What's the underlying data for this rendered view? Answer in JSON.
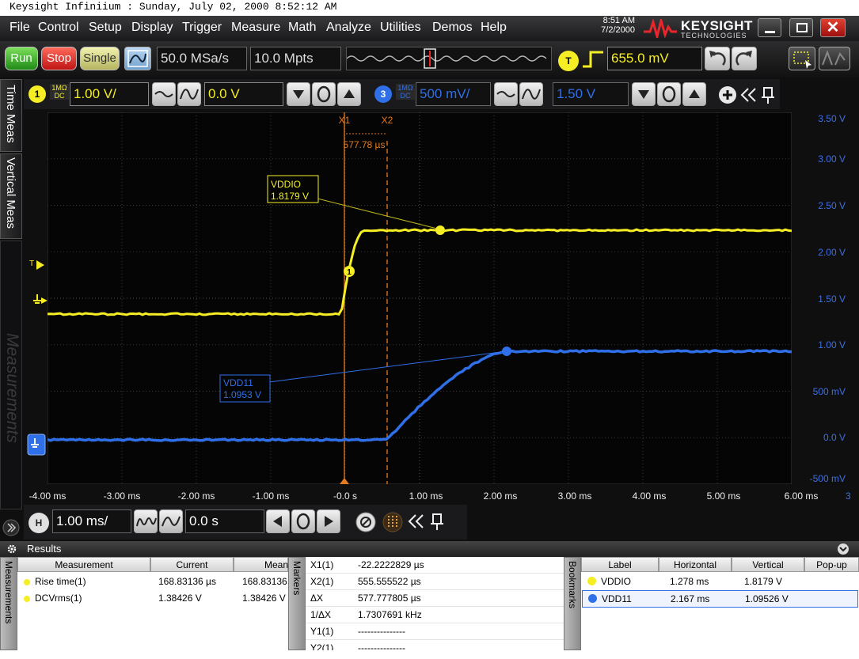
{
  "window_title": "Keysight Infiniium : Sunday, July 02, 2000 8:52:12 AM",
  "menu": [
    "File",
    "Control",
    "Setup",
    "Display",
    "Trigger",
    "Measure",
    "Math",
    "Analyze",
    "Utilities",
    "Demos",
    "Help"
  ],
  "clock": {
    "time": "8:51 AM",
    "date": "7/2/2000"
  },
  "brand": {
    "name": "KEYSIGHT",
    "sub": "TECHNOLOGIES"
  },
  "toolbar": {
    "run": "Run",
    "stop": "Stop",
    "single": "Single",
    "sample_rate": "50.0 MSa/s",
    "memory_depth": "10.0 Mpts",
    "trigger_badge": "T",
    "trigger_level": "655.0 mV"
  },
  "channel1": {
    "number": "1",
    "coupling_top": "1MΩ",
    "coupling_bot": "DC",
    "scale": "1.00 V/",
    "offset": "0.0 V",
    "color": "#f6ee25"
  },
  "channel3": {
    "number": "3",
    "coupling_top": "1MΩ",
    "coupling_bot": "DC",
    "scale": "500 mV/",
    "offset": "1.50 V",
    "color": "#2f6fe8"
  },
  "sidetabs": {
    "time_meas": "Time Meas",
    "vertical_meas": "Vertical Meas",
    "measurements": "Measurements"
  },
  "scope": {
    "y_labels": [
      "3.50 V",
      "3.00 V",
      "2.50 V",
      "2.00 V",
      "1.50 V",
      "1.00 V",
      "500 mV",
      "0.0 V",
      "-500 mV"
    ],
    "x_labels": [
      "-4.00 ms",
      "-3.00 ms",
      "-2.00 ms",
      "-1.00 ms",
      "-0.0 s",
      "1.00 ms",
      "2.00 ms",
      "3.00 ms",
      "4.00 ms",
      "5.00 ms",
      "6.00 ms"
    ],
    "x_extra": "3",
    "marker_x1": "X1",
    "marker_x2": "X2",
    "delta": "577.78 µs",
    "trig_marker": "T",
    "vddio_label": "VDDIO",
    "vddio_value": "1.8179 V",
    "vdd11_label": "VDD11",
    "vdd11_value": "1.0953 V",
    "meas_badge": "1"
  },
  "horizontal": {
    "badge": "H",
    "scale": "1.00 ms/",
    "position": "0.0 s"
  },
  "results": {
    "title": "Results",
    "measurements_tab": "Measurements",
    "markers_tab": "Markers",
    "bookmarks_tab": "Bookmarks",
    "meas_headers": [
      "Measurement",
      "Current",
      "Mean"
    ],
    "meas_rows": [
      {
        "name": "Rise time(1)",
        "current": "168.83136 µs",
        "mean": "168.83136"
      },
      {
        "name": "DCVrms(1)",
        "current": "1.38426 V",
        "mean": "1.38426 V"
      }
    ],
    "markers": [
      {
        "name": "X1(1)",
        "value": "-22.2222829 µs"
      },
      {
        "name": "X2(1)",
        "value": "555.555522 µs"
      },
      {
        "name": "ΔX",
        "value": "577.777805 µs"
      },
      {
        "name": "1/ΔX",
        "value": "1.7307691 kHz"
      },
      {
        "name": "Y1(1)",
        "value": "---------------"
      },
      {
        "name": "Y2(1)",
        "value": "---------------"
      }
    ],
    "bm_headers": [
      "Label",
      "Horizontal",
      "Vertical",
      "Pop-up"
    ],
    "bm_rows": [
      {
        "label": "VDDIO",
        "horizontal": "1.278 ms",
        "vertical": "1.8179 V",
        "color": "#f6ee25"
      },
      {
        "label": "VDD11",
        "horizontal": "2.167 ms",
        "vertical": "1.09526 V",
        "color": "#2f6fe8"
      }
    ]
  }
}
